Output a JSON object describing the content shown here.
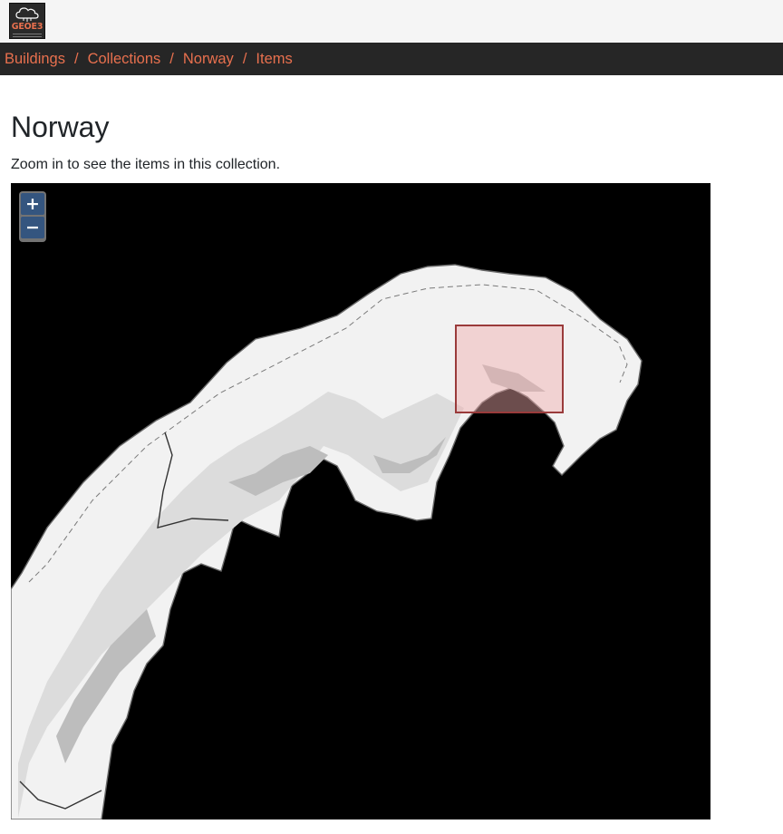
{
  "header": {
    "logo_text": "GEOE3",
    "logo_icon": "cloud-icon"
  },
  "breadcrumb": [
    {
      "label": "Buildings"
    },
    {
      "label": "Collections"
    },
    {
      "label": "Norway"
    },
    {
      "label": "Items"
    }
  ],
  "breadcrumb_separator": "/",
  "page": {
    "title": "Norway",
    "description": "Zoom in to see the items in this collection."
  },
  "map": {
    "zoom_in_label": "+",
    "zoom_out_label": "−",
    "background_color": "#000000",
    "land_color": "#f2f2f2",
    "extent_color": "#b03a3a"
  },
  "colors": {
    "accent": "#e8704e",
    "breadcrumb_bar": "#262626",
    "topbar": "#f5f5f5"
  }
}
